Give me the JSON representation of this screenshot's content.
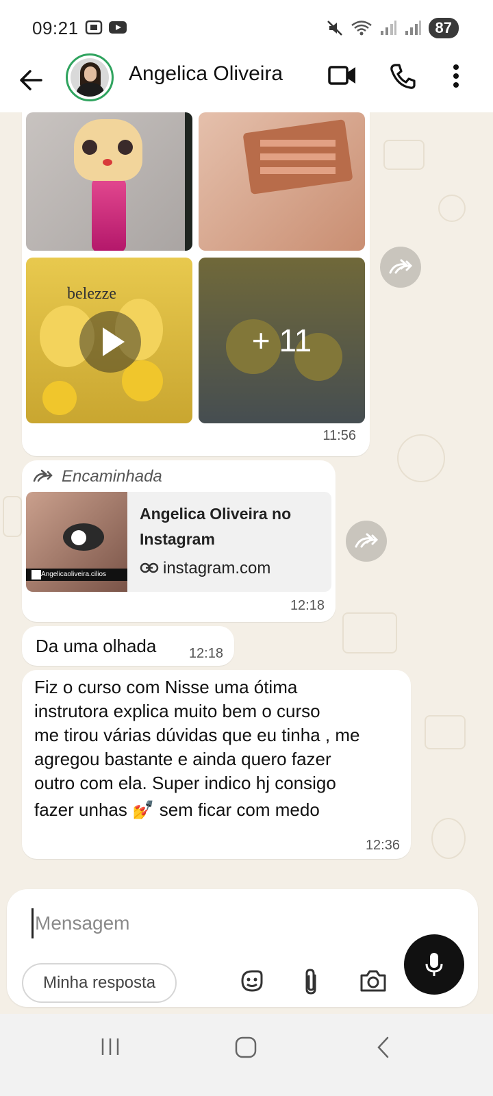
{
  "status_bar": {
    "time": "09:21",
    "battery": "87"
  },
  "header": {
    "contact_name": "Angelica Oliveira",
    "icons": [
      "back-arrow-icon",
      "video-call-icon",
      "phone-icon",
      "more-vert-icon"
    ]
  },
  "messages": {
    "album": {
      "more_count": "+ 11",
      "time": "11:56"
    },
    "forwarded": {
      "label": "Encaminhada",
      "link_title": "Angelica Oliveira no Instagram",
      "link_domain": "instagram.com",
      "thumb_caption": "Angelicaoliveira.cilios",
      "time": "12:18"
    },
    "short": {
      "text": "Da uma olhada",
      "time": "12:18"
    },
    "review": {
      "lines": [
        "Fiz o curso com Nisse uma ótima",
        "instrutora  explica muito bem  o curso",
        "me tirou várias dúvidas que eu tinha , me",
        "agregou bastante e ainda quero fazer",
        "outro com ela. Super indico hj consigo",
        "fazer unhas",
        "sem ficar com medo"
      ],
      "emoji": "💅",
      "time": "12:36"
    }
  },
  "composer": {
    "placeholder": "Mensagem",
    "reply_chip": "Minha resposta"
  },
  "colors": {
    "chat_bg": "#f4efe6",
    "avatar_ring": "#2fa35e",
    "mic_bg": "#111111"
  }
}
